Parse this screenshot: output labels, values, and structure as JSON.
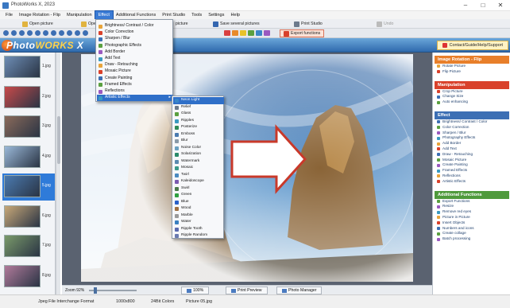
{
  "window": {
    "title": "PhotoWorks X, 2023"
  },
  "menubar": {
    "items": [
      "File",
      "Image Rotation - Flip",
      "Manipulation",
      "Effect",
      "Additional Functions",
      "Print Studio",
      "Tools",
      "Settings",
      "Help"
    ],
    "active_index": 3
  },
  "toolbar1": {
    "open_picture": "Open picture",
    "open_mode": "Ope",
    "picture_mode": "picture",
    "save_pictures": "Save several pictures",
    "print_studio": "Print Studio",
    "undo": "Undo",
    "export_functions": "Export functions"
  },
  "banner": {
    "logo_prefix": "Photo",
    "logo_main": "WORKS",
    "logo_suffix": "X",
    "contact": "Contact/Guide/Help/Support"
  },
  "thumbnails": [
    {
      "label": "1.jpg"
    },
    {
      "label": "2.jpg"
    },
    {
      "label": "3.jpg"
    },
    {
      "label": "4.jpg"
    },
    {
      "label": "5.jpg",
      "selected": true
    },
    {
      "label": "6.jpg"
    },
    {
      "label": "7.jpg"
    },
    {
      "label": "8.jpg"
    }
  ],
  "bottombar": {
    "zoom_label": "Zoom 92%",
    "btn_100": "100%",
    "btn_print_preview": "Print Preview",
    "btn_photo_manager": "Photo Manager"
  },
  "effects_menu": {
    "items": [
      "Brightness/ Contrast / Color",
      "Color Correction",
      "Sharpen / Blur",
      "Photographic Effects",
      "Add Border",
      "Add Text",
      "Draw - Retouching",
      "Mosaic Picture",
      "Create Painting",
      "Framed Effects",
      "Reflections",
      "Artistic Effects"
    ],
    "highlight_index": 11
  },
  "artistic_submenu": {
    "items": [
      "Neon Light",
      "Relief",
      "Glass",
      "Ripples",
      "Posterize",
      "Emboss",
      "Blur",
      "Noise Color",
      "Solarization",
      "Watermark",
      "Mosaic",
      "Twirl",
      "Kaleidoscope",
      "Swirl",
      "Green",
      "Blue",
      "Wood",
      "Marble",
      "Water",
      "Ripple Tooth",
      "Ripple Random"
    ],
    "highlight_index": 0
  },
  "rpanel": {
    "sections": [
      {
        "title": "Image Rotation - Flip",
        "color": "#e87f2a",
        "items": [
          "Rotate Picture",
          "Flip Picture"
        ]
      },
      {
        "title": "Manipulation",
        "color": "#d9412b",
        "items": [
          "Crop Picture",
          "Change Size",
          "Auto enhancing"
        ]
      },
      {
        "title": "Effect",
        "color": "#3c6fb4",
        "items": [
          "Brightness/ Contrast / Color",
          "Color Correction",
          "Sharpen / Blur",
          "Photography Effects",
          "Add Border",
          "Add Text",
          "Draw - Retouching",
          "Mosaic Picture",
          "Create Painting",
          "Framed Effects",
          "Reflections",
          "Artistic Effects"
        ]
      },
      {
        "title": "Additional Functions",
        "color": "#4f9a3c",
        "items": [
          "Export Functions",
          "Resize",
          "Remove red eyes",
          "Picture in Picture",
          "Insert Objects",
          "Numbers and icons",
          "Create collage",
          "Batch processing"
        ]
      }
    ]
  },
  "statusbar": {
    "format": "Jpeg File Interchange Format",
    "dimensions": "1000x800",
    "colors": "24Bit Colors",
    "file": "Picture 05.jpg"
  }
}
